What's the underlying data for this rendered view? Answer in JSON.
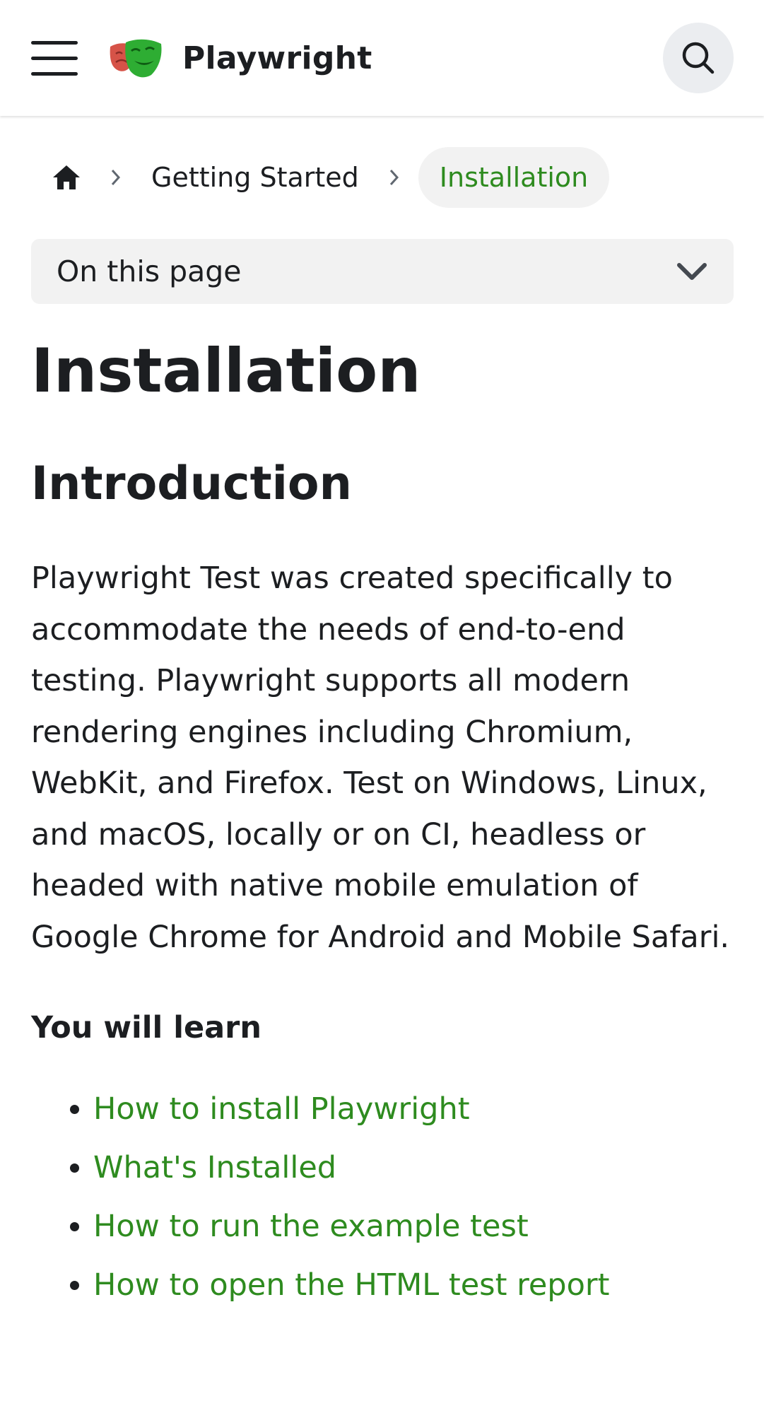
{
  "navbar": {
    "brand_title": "Playwright",
    "logo_icon": "playwright-masks-logo",
    "menu_icon": "hamburger-menu-icon",
    "search_icon": "search-icon"
  },
  "breadcrumbs": {
    "home_icon": "home-icon",
    "separator_icon": "chevron-right-icon",
    "items": [
      "Getting Started",
      "Installation"
    ]
  },
  "toc": {
    "label": "On this page",
    "icon": "chevron-down-icon"
  },
  "article": {
    "title": "Installation",
    "section_title": "Introduction",
    "intro": "Playwright Test was created specifically to accommodate the needs of end-to-end testing. Playwright supports all modern rendering engines including Chromium, WebKit, and Firefox. Test on Windows, Linux, and macOS, locally or on CI, headless or headed with native mobile emulation of Google Chrome for Android and Mobile Safari.",
    "learn_heading": "You will learn",
    "learn_items": [
      "How to install Playwright",
      "What's Installed",
      "How to run the example test",
      "How to open the HTML test report"
    ]
  },
  "colors": {
    "link_green": "#2e8b1f",
    "text": "#1c1e21",
    "pill_bg": "#f2f2f2",
    "search_bg": "#ebedf0"
  }
}
